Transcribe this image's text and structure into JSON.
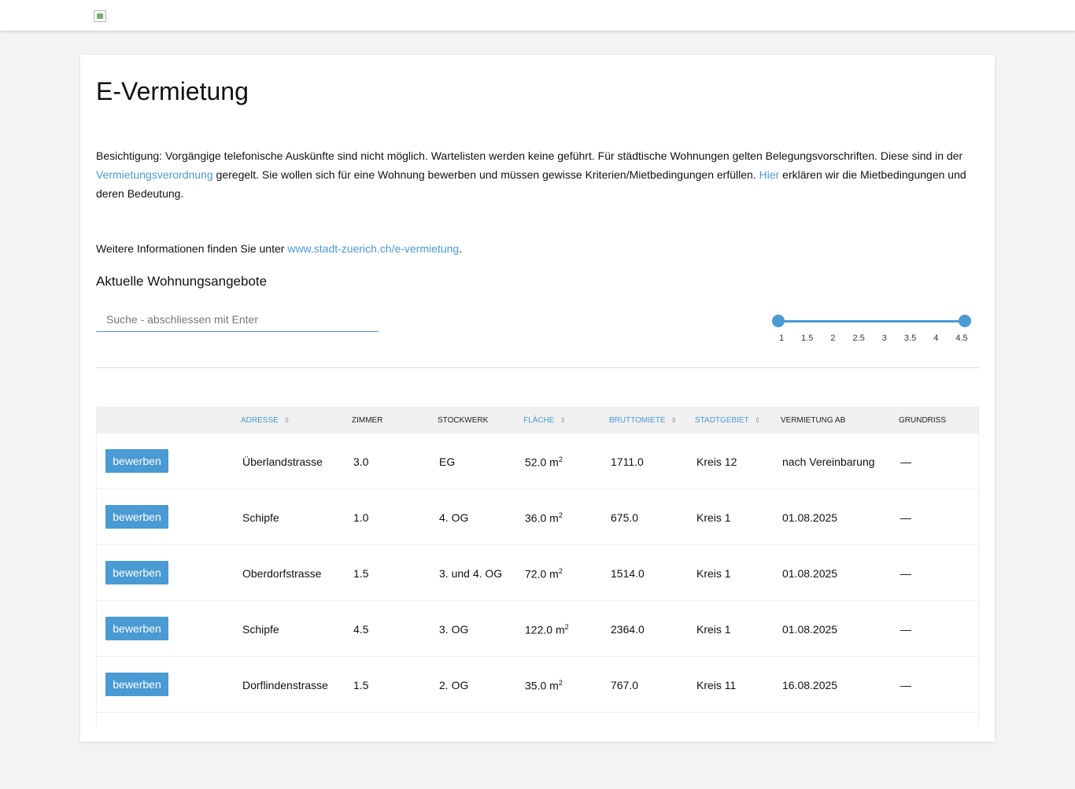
{
  "header": {
    "logo_alt": ""
  },
  "page": {
    "title": "E-Vermietung",
    "intro_part1": "Besichtigung: Vorgängige telefonische Auskünfte sind nicht möglich. Wartelisten werden keine geführt. Für städtische Wohnungen gelten Belegungsvorschriften. Diese sind in der ",
    "intro_link1": "Vermietungsverordnung",
    "intro_part2": " geregelt. Sie wollen sich für eine Wohnung bewerben und müssen gewisse Kriterien/Mietbedingungen erfüllen. ",
    "intro_link2": "Hier",
    "intro_part3": " erklären wir die Mietbedingungen und deren Bedeutung.",
    "more_prefix": "Weitere Informationen finden Sie unter ",
    "more_link": "www.stadt-zuerich.ch/e-vermietung",
    "more_suffix": ".",
    "section_title": "Aktuelle Wohnungsangebote"
  },
  "search": {
    "placeholder": "Suche - abschliessen mit Enter",
    "value": ""
  },
  "rooms_filter": {
    "ticks": [
      "1",
      "1.5",
      "2",
      "2.5",
      "3",
      "3.5",
      "4",
      "4.5"
    ],
    "min": 1,
    "max": 4.5,
    "selected_min": 1,
    "selected_max": 4.5
  },
  "table": {
    "columns": {
      "adresse": "Adresse",
      "zimmer": "Zimmer",
      "stockwerk": "Stockwerk",
      "flaeche": "Fläche",
      "bruttomiete": "Bruttomiete",
      "stadtgebiet": "Stadtgebiet",
      "vermietung_ab": "Vermietung ab",
      "grundriss": "Grundriss"
    },
    "sort_icon": "⇳",
    "apply_label": "bewerben",
    "area_unit": "m",
    "area_exp": "2",
    "rows": [
      {
        "adresse": "Überlandstrasse",
        "zimmer": "3.0",
        "stockwerk": "EG",
        "flaeche": "52.0",
        "bruttomiete": "1711.0",
        "stadtgebiet": "Kreis 12",
        "vermietung_ab": "nach Vereinbarung",
        "grundriss": "—"
      },
      {
        "adresse": "Schipfe",
        "zimmer": "1.0",
        "stockwerk": "4. OG",
        "flaeche": "36.0",
        "bruttomiete": "675.0",
        "stadtgebiet": "Kreis 1",
        "vermietung_ab": "01.08.2025",
        "grundriss": "—"
      },
      {
        "adresse": "Oberdorfstrasse",
        "zimmer": "1.5",
        "stockwerk": "3. und 4. OG",
        "flaeche": "72.0",
        "bruttomiete": "1514.0",
        "stadtgebiet": "Kreis 1",
        "vermietung_ab": "01.08.2025",
        "grundriss": "—"
      },
      {
        "adresse": "Schipfe",
        "zimmer": "4.5",
        "stockwerk": "3. OG",
        "flaeche": "122.0",
        "bruttomiete": "2364.0",
        "stadtgebiet": "Kreis 1",
        "vermietung_ab": "01.08.2025",
        "grundriss": "—"
      },
      {
        "adresse": "Dorflindenstrasse",
        "zimmer": "1.5",
        "stockwerk": "2. OG",
        "flaeche": "35.0",
        "bruttomiete": "767.0",
        "stadtgebiet": "Kreis 11",
        "vermietung_ab": "16.08.2025",
        "grundriss": "—"
      }
    ]
  },
  "colors": {
    "accent": "#4a9ad4",
    "background": "#f3f3f3",
    "card": "#ffffff"
  }
}
